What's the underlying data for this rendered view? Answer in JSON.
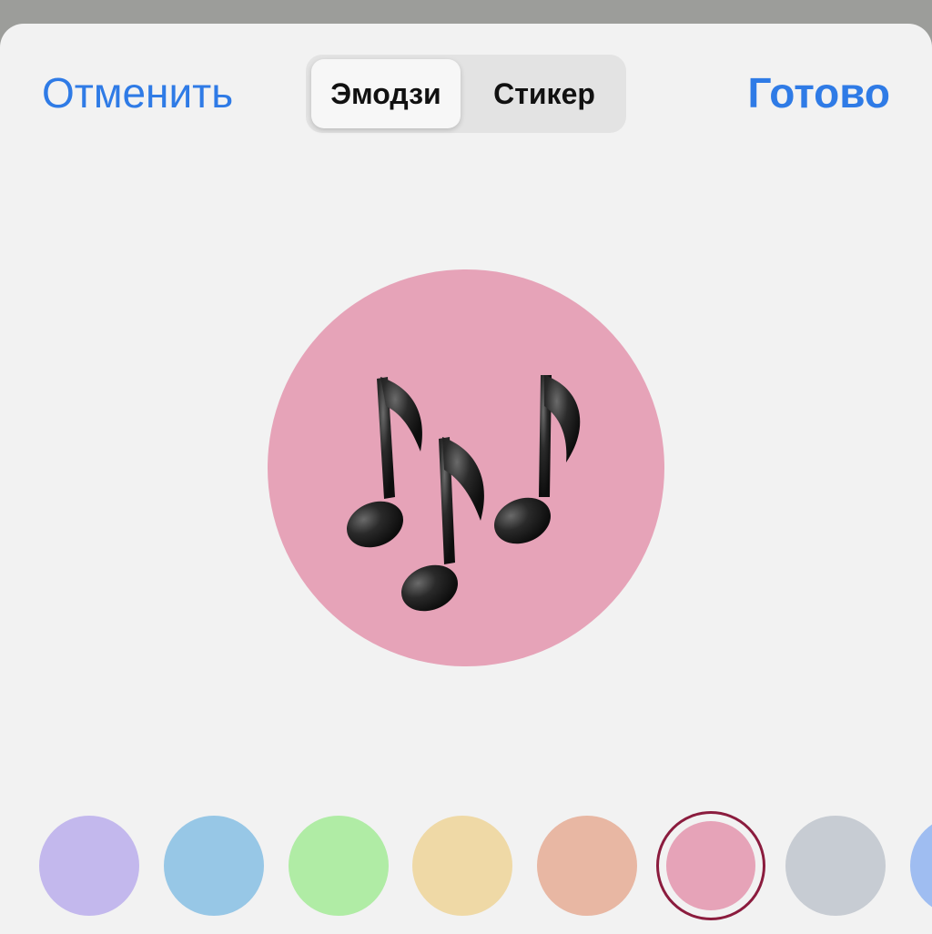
{
  "header": {
    "cancel_label": "Отменить",
    "done_label": "Готово",
    "tabs": [
      {
        "label": "Эмодзи",
        "selected": true
      },
      {
        "label": "Стикер",
        "selected": false
      }
    ]
  },
  "preview": {
    "background_color": "#e6a3b8",
    "emoji_icon": "musical-notes-icon"
  },
  "colors": {
    "accent": "#2f7be6",
    "selected_ring": "#8b1c3e"
  },
  "swatches": [
    {
      "name": "lavender",
      "color": "#c3b8ed",
      "selected": false
    },
    {
      "name": "blue",
      "color": "#97c7e6",
      "selected": false
    },
    {
      "name": "green",
      "color": "#b0eca5",
      "selected": false
    },
    {
      "name": "yellow",
      "color": "#efd9a6",
      "selected": false
    },
    {
      "name": "peach",
      "color": "#e8b7a3",
      "selected": false
    },
    {
      "name": "pink",
      "color": "#e6a3b8",
      "selected": true
    },
    {
      "name": "gray",
      "color": "#c7ccd3",
      "selected": false
    },
    {
      "name": "periwinkle",
      "color": "#9fbdf1",
      "selected": false
    }
  ]
}
